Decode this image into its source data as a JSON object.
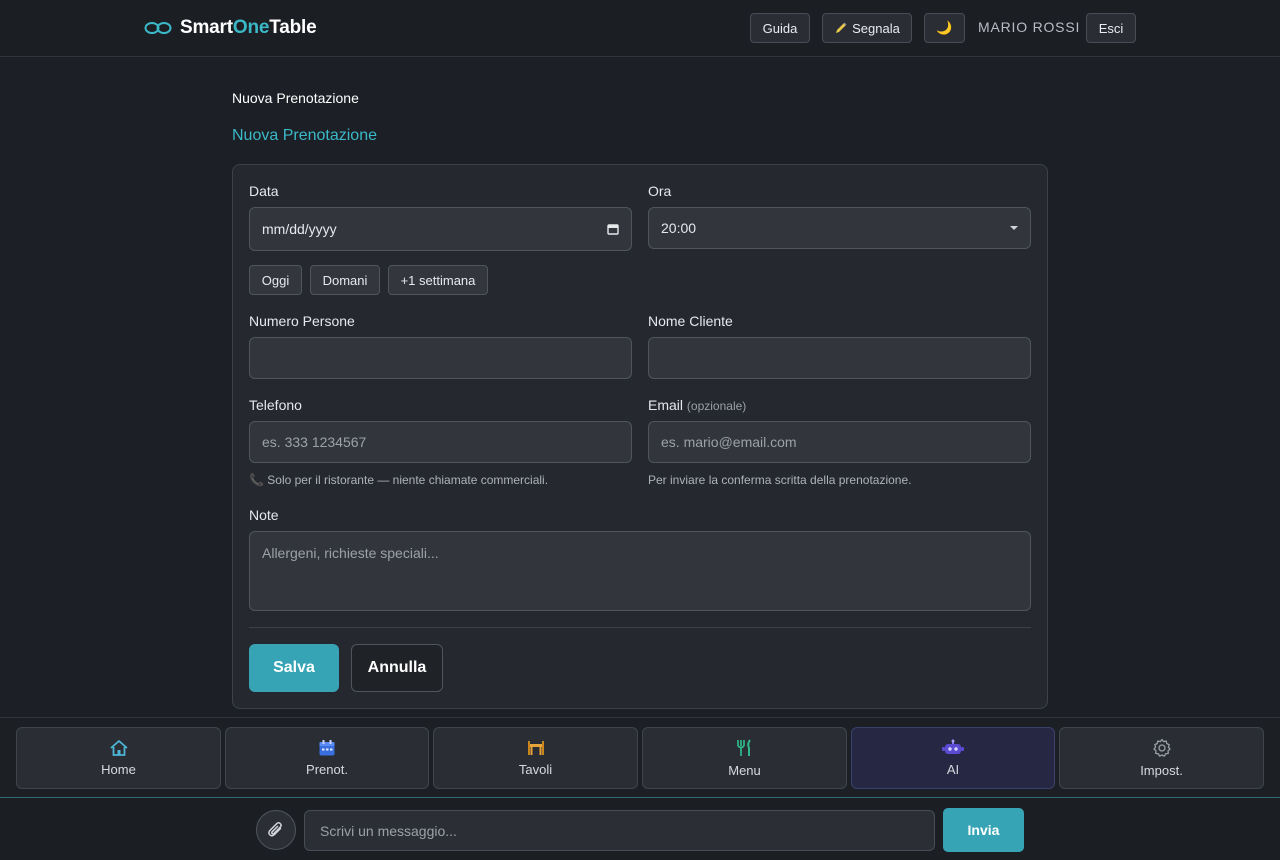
{
  "app": {
    "brand_part1": "Smart",
    "brand_part2": "One",
    "brand_part3": "Table"
  },
  "header": {
    "guide_label": "Guida",
    "report_label": "Segnala",
    "report_icon": "pencil-icon",
    "theme_icon": "moon-icon",
    "theme_glyph": "🌙",
    "user_name": "MARIO ROSSI",
    "logout_label": "Esci"
  },
  "page": {
    "breadcrumb": "Nuova Prenotazione",
    "title": "Nuova Prenotazione"
  },
  "form": {
    "date": {
      "label": "Data",
      "placeholder": "mm/dd/yyyy"
    },
    "time": {
      "label": "Ora",
      "value": "20:00"
    },
    "quick_dates": [
      "Oggi",
      "Domani",
      "+1 settimana"
    ],
    "guests": {
      "label": "Numero Persone",
      "value": ""
    },
    "name": {
      "label": "Nome Cliente",
      "value": ""
    },
    "phone": {
      "label": "Telefono",
      "placeholder": "es. 333 1234567",
      "help": "📞 Solo per il ristorante — niente chiamate commerciali."
    },
    "email": {
      "label": "Email",
      "optional": "(opzionale)",
      "placeholder": "es. mario@email.com",
      "help": "Per inviare la conferma scritta della prenotazione."
    },
    "notes": {
      "label": "Note",
      "placeholder": "Allergeni, richieste speciali..."
    },
    "save_label": "Salva",
    "cancel_label": "Annulla"
  },
  "nav": {
    "items": [
      {
        "label": "Home",
        "icon": "home-icon"
      },
      {
        "label": "Prenot.",
        "icon": "calendar-icon"
      },
      {
        "label": "Tavoli",
        "icon": "table-icon"
      },
      {
        "label": "Menu",
        "icon": "fork-knife-icon"
      },
      {
        "label": "AI",
        "icon": "robot-icon",
        "active": true
      },
      {
        "label": "Impost.",
        "icon": "gear-icon"
      }
    ]
  },
  "chat": {
    "placeholder": "Scrivi un messaggio...",
    "send_label": "Invia"
  },
  "colors": {
    "accent": "#3bb8c7",
    "primary_button": "#36a4b5",
    "background": "#1c2026"
  }
}
